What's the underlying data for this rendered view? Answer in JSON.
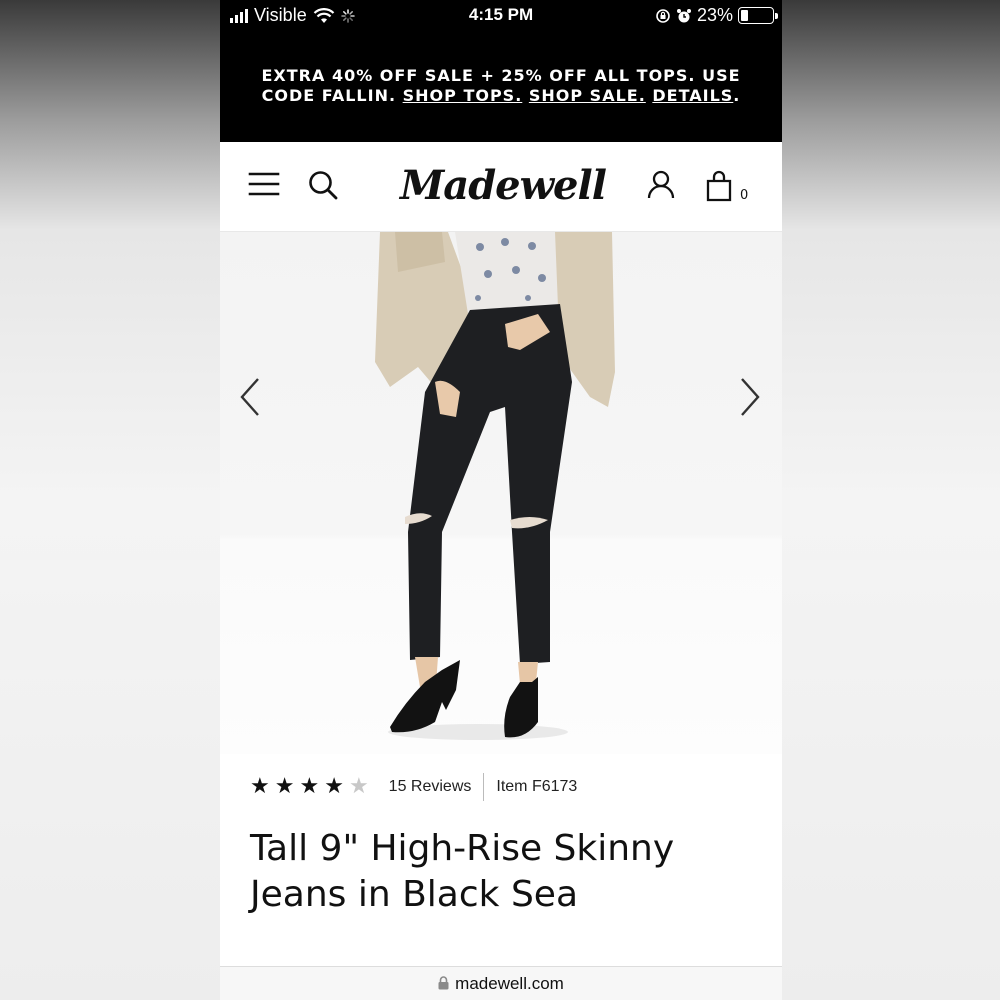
{
  "status_bar": {
    "carrier": "Visible",
    "time": "4:15 PM",
    "battery_percent": "23%",
    "battery_level": 0.23
  },
  "promo": {
    "text": "EXTRA 40% OFF SALE + 25% OFF ALL TOPS. USE CODE FALLIN.",
    "link_shop_tops": "SHOP TOPS.",
    "link_shop_sale": "SHOP SALE.",
    "link_details": "DETAILS"
  },
  "header": {
    "logo": "Madewell",
    "bag_count": "0"
  },
  "product": {
    "rating": 4,
    "rating_max": 5,
    "reviews_label": "15 Reviews",
    "item_label": "Item F6173",
    "title": "Tall 9\" High-Rise Skinny Jeans in Black Sea"
  },
  "browser": {
    "url": "madewell.com"
  },
  "colors": {
    "banner_bg": "#000000",
    "text": "#111111",
    "star_off": "#c8c8c8"
  }
}
